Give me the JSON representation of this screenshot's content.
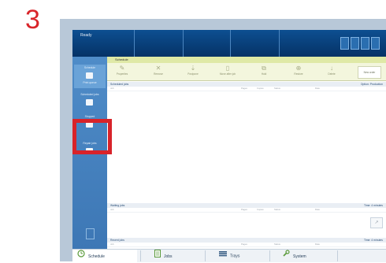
{
  "step": "3",
  "app": {
    "title": "Ready"
  },
  "sidebar": {
    "items": [
      {
        "label": "Schedule",
        "sub": "Print queue",
        "active": true
      },
      {
        "label": "Scheduled jobs",
        "sub": ""
      },
      {
        "label": "Stopped",
        "sub": ""
      },
      {
        "label": "Repair jobs",
        "sub": ""
      }
    ]
  },
  "content": {
    "title": "Schedule",
    "toolbar": [
      "Properties",
      "Remove",
      "Postpone",
      "Move after job",
      "Hold",
      "Restore",
      "Delete"
    ],
    "toolbar_new": "New order",
    "sections": [
      {
        "title": "Scheduled jobs",
        "right": "Option: Production",
        "columns": [
          "Job",
          "Pages",
          "Copies",
          "Status",
          "Date"
        ]
      },
      {
        "title": "Waiting jobs",
        "right": "Time: 4 minutes",
        "columns": [
          "Job",
          "Pages",
          "Copies",
          "Status",
          "Date"
        ]
      },
      {
        "title": "Recent jobs",
        "right": "Time: 4 minutes",
        "columns": [
          "Job",
          "Pages",
          "Status",
          "Date"
        ]
      }
    ]
  },
  "bottom_nav": {
    "items": [
      {
        "label": "Schedule",
        "icon": "clock-icon"
      },
      {
        "label": "Jobs",
        "icon": "document-icon"
      },
      {
        "label": "Trays",
        "icon": "trays-icon"
      },
      {
        "label": "System",
        "icon": "wrench-icon"
      }
    ]
  },
  "colors": {
    "highlight": "#d8232a",
    "topbar": "#0d4f91",
    "sidebar": "#4f8cc8",
    "toolbar": "#f3f6dd"
  }
}
